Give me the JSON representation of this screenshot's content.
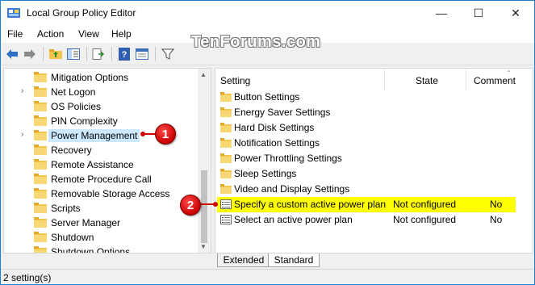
{
  "window": {
    "title": "Local Group Policy Editor",
    "watermark": "TenForums.com",
    "controls": {
      "minimize": "—",
      "maximize": "☐",
      "close": "✕"
    }
  },
  "menu": [
    "File",
    "Action",
    "View",
    "Help"
  ],
  "toolbar": {
    "icons": [
      "back-arrow-icon",
      "forward-arrow-icon",
      "up-folder-icon",
      "show-hide-tree-icon",
      "export-list-icon",
      "help-icon",
      "properties-icon",
      "filter-icon"
    ]
  },
  "tree": {
    "items": [
      {
        "label": "Mitigation Options",
        "expandable": false,
        "selected": false
      },
      {
        "label": "Net Logon",
        "expandable": true,
        "selected": false
      },
      {
        "label": "OS Policies",
        "expandable": false,
        "selected": false
      },
      {
        "label": "PIN Complexity",
        "expandable": false,
        "selected": false
      },
      {
        "label": "Power Management",
        "expandable": true,
        "selected": true
      },
      {
        "label": "Recovery",
        "expandable": false,
        "selected": false
      },
      {
        "label": "Remote Assistance",
        "expandable": false,
        "selected": false
      },
      {
        "label": "Remote Procedure Call",
        "expandable": false,
        "selected": false
      },
      {
        "label": "Removable Storage Access",
        "expandable": false,
        "selected": false
      },
      {
        "label": "Scripts",
        "expandable": false,
        "selected": false
      },
      {
        "label": "Server Manager",
        "expandable": false,
        "selected": false
      },
      {
        "label": "Shutdown",
        "expandable": false,
        "selected": false
      },
      {
        "label": "Shutdown Options",
        "expandable": false,
        "selected": false
      }
    ]
  },
  "list": {
    "columns": {
      "setting": "Setting",
      "state": "State",
      "comment": "Comment"
    },
    "rows": [
      {
        "name": "Button Settings",
        "type": "folder",
        "state": "",
        "comment": ""
      },
      {
        "name": "Energy Saver Settings",
        "type": "folder",
        "state": "",
        "comment": ""
      },
      {
        "name": "Hard Disk Settings",
        "type": "folder",
        "state": "",
        "comment": ""
      },
      {
        "name": "Notification Settings",
        "type": "folder",
        "state": "",
        "comment": ""
      },
      {
        "name": "Power Throttling Settings",
        "type": "folder",
        "state": "",
        "comment": ""
      },
      {
        "name": "Sleep Settings",
        "type": "folder",
        "state": "",
        "comment": ""
      },
      {
        "name": "Video and Display Settings",
        "type": "folder",
        "state": "",
        "comment": ""
      },
      {
        "name": "Specify a custom active power plan",
        "type": "setting",
        "state": "Not configured",
        "comment": "No",
        "highlighted": true
      },
      {
        "name": "Select an active power plan",
        "type": "setting",
        "state": "Not configured",
        "comment": "No"
      }
    ]
  },
  "tabs": {
    "extended": "Extended",
    "standard": "Standard",
    "active": "Standard"
  },
  "status": {
    "text": "2 setting(s)"
  },
  "callouts": {
    "one": "1",
    "two": "2"
  },
  "colors": {
    "highlight": "#ffff00",
    "selection": "#cce8ff",
    "callout": "#c80000",
    "accent": "#1883d7"
  }
}
